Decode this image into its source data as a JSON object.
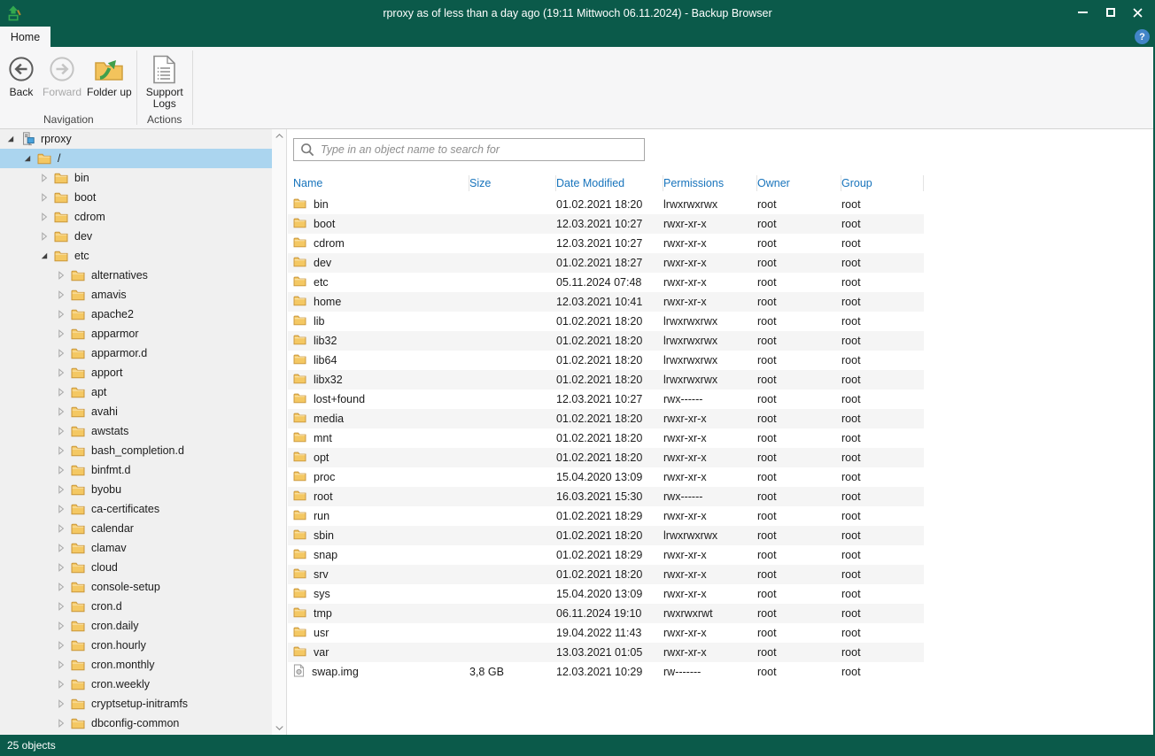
{
  "window": {
    "title": "rproxy as of less than a day ago (19:11 Mittwoch 06.11.2024) - Backup Browser",
    "controls": {
      "minimize": "minimize",
      "maximize": "maximize",
      "close": "close",
      "help": "?"
    }
  },
  "tabs": [
    {
      "label": "Home",
      "active": true
    }
  ],
  "ribbon": {
    "groups": [
      {
        "label": "Navigation",
        "buttons": [
          {
            "label": "Back",
            "icon": "back-icon",
            "enabled": true
          },
          {
            "label": "Forward",
            "icon": "forward-icon",
            "enabled": false
          },
          {
            "label": "Folder up",
            "icon": "folder-up-icon",
            "enabled": true
          }
        ]
      },
      {
        "label": "Actions",
        "buttons": [
          {
            "label": "Support Logs",
            "icon": "support-logs-icon",
            "enabled": true
          }
        ]
      }
    ]
  },
  "sidebar": {
    "items": [
      {
        "label": "rproxy",
        "level": 0,
        "type": "server",
        "state": "open",
        "selected": false
      },
      {
        "label": "/",
        "level": 1,
        "type": "folder",
        "state": "open",
        "selected": true
      },
      {
        "label": "bin",
        "level": 2,
        "type": "folder",
        "state": "closed",
        "selected": false
      },
      {
        "label": "boot",
        "level": 2,
        "type": "folder",
        "state": "closed",
        "selected": false
      },
      {
        "label": "cdrom",
        "level": 2,
        "type": "folder",
        "state": "closed",
        "selected": false
      },
      {
        "label": "dev",
        "level": 2,
        "type": "folder",
        "state": "closed",
        "selected": false
      },
      {
        "label": "etc",
        "level": 2,
        "type": "folder",
        "state": "open",
        "selected": false
      },
      {
        "label": "alternatives",
        "level": 3,
        "type": "folder",
        "state": "closed",
        "selected": false
      },
      {
        "label": "amavis",
        "level": 3,
        "type": "folder",
        "state": "closed",
        "selected": false
      },
      {
        "label": "apache2",
        "level": 3,
        "type": "folder",
        "state": "closed",
        "selected": false
      },
      {
        "label": "apparmor",
        "level": 3,
        "type": "folder",
        "state": "closed",
        "selected": false
      },
      {
        "label": "apparmor.d",
        "level": 3,
        "type": "folder",
        "state": "closed",
        "selected": false
      },
      {
        "label": "apport",
        "level": 3,
        "type": "folder",
        "state": "closed",
        "selected": false
      },
      {
        "label": "apt",
        "level": 3,
        "type": "folder",
        "state": "closed",
        "selected": false
      },
      {
        "label": "avahi",
        "level": 3,
        "type": "folder",
        "state": "closed",
        "selected": false
      },
      {
        "label": "awstats",
        "level": 3,
        "type": "folder",
        "state": "closed",
        "selected": false
      },
      {
        "label": "bash_completion.d",
        "level": 3,
        "type": "folder",
        "state": "closed",
        "selected": false
      },
      {
        "label": "binfmt.d",
        "level": 3,
        "type": "folder",
        "state": "closed",
        "selected": false
      },
      {
        "label": "byobu",
        "level": 3,
        "type": "folder",
        "state": "closed",
        "selected": false
      },
      {
        "label": "ca-certificates",
        "level": 3,
        "type": "folder",
        "state": "closed",
        "selected": false
      },
      {
        "label": "calendar",
        "level": 3,
        "type": "folder",
        "state": "closed",
        "selected": false
      },
      {
        "label": "clamav",
        "level": 3,
        "type": "folder",
        "state": "closed",
        "selected": false
      },
      {
        "label": "cloud",
        "level": 3,
        "type": "folder",
        "state": "closed",
        "selected": false
      },
      {
        "label": "console-setup",
        "level": 3,
        "type": "folder",
        "state": "closed",
        "selected": false
      },
      {
        "label": "cron.d",
        "level": 3,
        "type": "folder",
        "state": "closed",
        "selected": false
      },
      {
        "label": "cron.daily",
        "level": 3,
        "type": "folder",
        "state": "closed",
        "selected": false
      },
      {
        "label": "cron.hourly",
        "level": 3,
        "type": "folder",
        "state": "closed",
        "selected": false
      },
      {
        "label": "cron.monthly",
        "level": 3,
        "type": "folder",
        "state": "closed",
        "selected": false
      },
      {
        "label": "cron.weekly",
        "level": 3,
        "type": "folder",
        "state": "closed",
        "selected": false
      },
      {
        "label": "cryptsetup-initramfs",
        "level": 3,
        "type": "folder",
        "state": "closed",
        "selected": false
      },
      {
        "label": "dbconfig-common",
        "level": 3,
        "type": "folder",
        "state": "closed",
        "selected": false
      }
    ]
  },
  "search": {
    "placeholder": "Type in an object name to search for"
  },
  "table": {
    "columns": [
      {
        "label": "Name"
      },
      {
        "label": "Size"
      },
      {
        "label": "Date Modified"
      },
      {
        "label": "Permissions"
      },
      {
        "label": "Owner"
      },
      {
        "label": "Group"
      }
    ],
    "rows": [
      {
        "name": "bin",
        "type": "folder",
        "size": "",
        "modified": "01.02.2021 18:20",
        "permissions": "lrwxrwxrwx",
        "owner": "root",
        "group": "root"
      },
      {
        "name": "boot",
        "type": "folder",
        "size": "",
        "modified": "12.03.2021 10:27",
        "permissions": "rwxr-xr-x",
        "owner": "root",
        "group": "root"
      },
      {
        "name": "cdrom",
        "type": "folder",
        "size": "",
        "modified": "12.03.2021 10:27",
        "permissions": "rwxr-xr-x",
        "owner": "root",
        "group": "root"
      },
      {
        "name": "dev",
        "type": "folder",
        "size": "",
        "modified": "01.02.2021 18:27",
        "permissions": "rwxr-xr-x",
        "owner": "root",
        "group": "root"
      },
      {
        "name": "etc",
        "type": "folder",
        "size": "",
        "modified": "05.11.2024 07:48",
        "permissions": "rwxr-xr-x",
        "owner": "root",
        "group": "root"
      },
      {
        "name": "home",
        "type": "folder",
        "size": "",
        "modified": "12.03.2021 10:41",
        "permissions": "rwxr-xr-x",
        "owner": "root",
        "group": "root"
      },
      {
        "name": "lib",
        "type": "folder",
        "size": "",
        "modified": "01.02.2021 18:20",
        "permissions": "lrwxrwxrwx",
        "owner": "root",
        "group": "root"
      },
      {
        "name": "lib32",
        "type": "folder",
        "size": "",
        "modified": "01.02.2021 18:20",
        "permissions": "lrwxrwxrwx",
        "owner": "root",
        "group": "root"
      },
      {
        "name": "lib64",
        "type": "folder",
        "size": "",
        "modified": "01.02.2021 18:20",
        "permissions": "lrwxrwxrwx",
        "owner": "root",
        "group": "root"
      },
      {
        "name": "libx32",
        "type": "folder",
        "size": "",
        "modified": "01.02.2021 18:20",
        "permissions": "lrwxrwxrwx",
        "owner": "root",
        "group": "root"
      },
      {
        "name": "lost+found",
        "type": "folder",
        "size": "",
        "modified": "12.03.2021 10:27",
        "permissions": "rwx------",
        "owner": "root",
        "group": "root"
      },
      {
        "name": "media",
        "type": "folder",
        "size": "",
        "modified": "01.02.2021 18:20",
        "permissions": "rwxr-xr-x",
        "owner": "root",
        "group": "root"
      },
      {
        "name": "mnt",
        "type": "folder",
        "size": "",
        "modified": "01.02.2021 18:20",
        "permissions": "rwxr-xr-x",
        "owner": "root",
        "group": "root"
      },
      {
        "name": "opt",
        "type": "folder",
        "size": "",
        "modified": "01.02.2021 18:20",
        "permissions": "rwxr-xr-x",
        "owner": "root",
        "group": "root"
      },
      {
        "name": "proc",
        "type": "folder",
        "size": "",
        "modified": "15.04.2020 13:09",
        "permissions": "rwxr-xr-x",
        "owner": "root",
        "group": "root"
      },
      {
        "name": "root",
        "type": "folder",
        "size": "",
        "modified": "16.03.2021 15:30",
        "permissions": "rwx------",
        "owner": "root",
        "group": "root"
      },
      {
        "name": "run",
        "type": "folder",
        "size": "",
        "modified": "01.02.2021 18:29",
        "permissions": "rwxr-xr-x",
        "owner": "root",
        "group": "root"
      },
      {
        "name": "sbin",
        "type": "folder",
        "size": "",
        "modified": "01.02.2021 18:20",
        "permissions": "lrwxrwxrwx",
        "owner": "root",
        "group": "root"
      },
      {
        "name": "snap",
        "type": "folder",
        "size": "",
        "modified": "01.02.2021 18:29",
        "permissions": "rwxr-xr-x",
        "owner": "root",
        "group": "root"
      },
      {
        "name": "srv",
        "type": "folder",
        "size": "",
        "modified": "01.02.2021 18:20",
        "permissions": "rwxr-xr-x",
        "owner": "root",
        "group": "root"
      },
      {
        "name": "sys",
        "type": "folder",
        "size": "",
        "modified": "15.04.2020 13:09",
        "permissions": "rwxr-xr-x",
        "owner": "root",
        "group": "root"
      },
      {
        "name": "tmp",
        "type": "folder",
        "size": "",
        "modified": "06.11.2024 19:10",
        "permissions": "rwxrwxrwt",
        "owner": "root",
        "group": "root"
      },
      {
        "name": "usr",
        "type": "folder",
        "size": "",
        "modified": "19.04.2022 11:43",
        "permissions": "rwxr-xr-x",
        "owner": "root",
        "group": "root"
      },
      {
        "name": "var",
        "type": "folder",
        "size": "",
        "modified": "13.03.2021 01:05",
        "permissions": "rwxr-xr-x",
        "owner": "root",
        "group": "root"
      },
      {
        "name": "swap.img",
        "type": "file",
        "size": "3,8 GB",
        "modified": "12.03.2021 10:29",
        "permissions": "rw-------",
        "owner": "root",
        "group": "root"
      }
    ]
  },
  "status_bar": {
    "text": "25 objects"
  },
  "colors": {
    "titlebar_green": "#0b5a4a",
    "selection_blue": "#abd5ef",
    "header_text_blue": "#1874bc",
    "folder_yellow": "#f4c863",
    "row_alt_gray": "#f5f5f5"
  }
}
